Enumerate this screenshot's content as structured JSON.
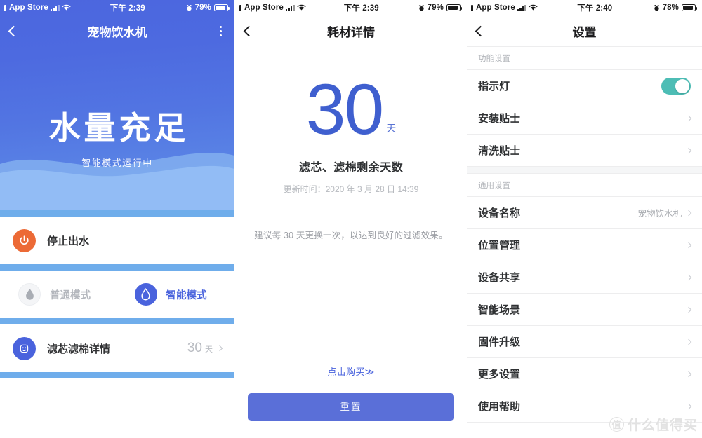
{
  "screens": [
    {
      "id": "device-home",
      "status_bar": {
        "carrier_label": "App Store",
        "time": "下午 2:39",
        "battery_percent": "79%",
        "icons": [
          "back-to-appstore-icon",
          "signal-bars-icon",
          "wifi-icon",
          "alarm-icon",
          "battery-icon"
        ]
      },
      "nav": {
        "back_icon": "chevron-left-icon",
        "title": "宠物饮水机",
        "more_icon": "more-vertical-icon"
      },
      "hero": {
        "title": "水量充足",
        "subtitle": "智能模式运行中",
        "gradient_top": "#4a63dd",
        "gradient_bottom": "#5b86e6",
        "wave_color": "#8cb4f0"
      },
      "stop_row": {
        "icon": "power-icon",
        "icon_bg": "#ec6a36",
        "label": "停止出水"
      },
      "modes": [
        {
          "label": "普通模式",
          "icon": "water-drop-icon",
          "active": false
        },
        {
          "label": "智能模式",
          "icon": "water-drop-icon",
          "active": true
        }
      ],
      "filter_row": {
        "icon": "filter-cartridge-icon",
        "icon_bg": "#4a63dd",
        "label": "滤芯滤棉详情",
        "value": "30",
        "unit": "天",
        "chevron": "chevron-right-icon"
      },
      "divider_color": "#6fadeb"
    },
    {
      "id": "consumable-detail",
      "status_bar": {
        "carrier_label": "App Store",
        "time": "下午 2:39",
        "battery_percent": "79%"
      },
      "nav": {
        "back_icon": "chevron-left-icon",
        "title": "耗材详情"
      },
      "days_value": "30",
      "days_unit": "天",
      "caption": "滤芯、滤棉剩余天数",
      "updated_time": "更新时间：2020 年 3 月 28 日 14:39",
      "note": "建议每 30 天更换一次，以达到良好的过滤效果。",
      "buy_link": "点击购买≫",
      "reset_button": "重置",
      "accent_color": "#4a63dd"
    },
    {
      "id": "settings",
      "status_bar": {
        "carrier_label": "App Store",
        "time": "下午 2:40",
        "battery_percent": "78%"
      },
      "nav": {
        "back_icon": "chevron-left-icon",
        "title": "设置"
      },
      "groups": [
        {
          "header": "功能设置",
          "rows": [
            {
              "label": "指示灯",
              "type": "toggle",
              "toggle_on": true,
              "toggle_color": "#4dbdb5"
            },
            {
              "label": "安装贴士",
              "type": "link",
              "value": ""
            },
            {
              "label": "清洗贴士",
              "type": "link",
              "value": ""
            }
          ]
        },
        {
          "header": "通用设置",
          "rows": [
            {
              "label": "设备名称",
              "type": "link",
              "value": "宠物饮水机"
            },
            {
              "label": "位置管理",
              "type": "link",
              "value": ""
            },
            {
              "label": "设备共享",
              "type": "link",
              "value": ""
            },
            {
              "label": "智能场景",
              "type": "link",
              "value": ""
            },
            {
              "label": "固件升级",
              "type": "link",
              "value": ""
            },
            {
              "label": "更多设置",
              "type": "link",
              "value": ""
            },
            {
              "label": "使用帮助",
              "type": "link",
              "value": ""
            }
          ]
        }
      ],
      "watermark": {
        "mark": "值",
        "text": "什么值得买"
      }
    }
  ]
}
